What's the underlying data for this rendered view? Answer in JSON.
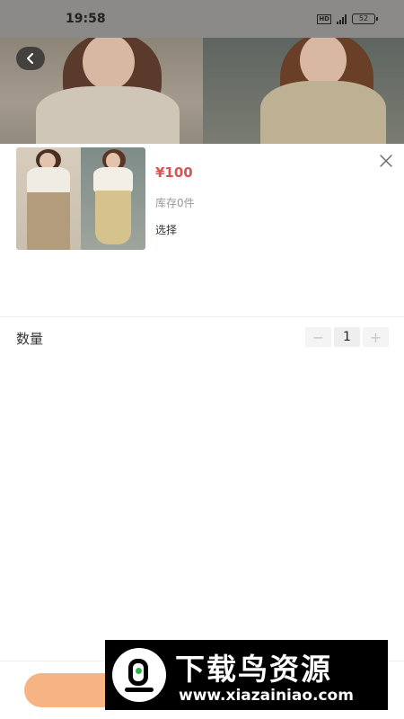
{
  "status_bar": {
    "time": "19:58",
    "hd_badge": "HD",
    "network": "4G",
    "battery": "52"
  },
  "gallery": {
    "back_icon": "chevron-left-icon"
  },
  "sku_sheet": {
    "price": "¥100",
    "stock": "库存0件",
    "select_label": "选择",
    "close_icon": "close-icon",
    "quantity": {
      "label": "数量",
      "value": "1",
      "minus": "−",
      "plus": "+"
    },
    "confirm_color": "#f6b485"
  },
  "watermark": {
    "title": "下载鸟资源",
    "url": "www.xiazainiao.com"
  },
  "colors": {
    "price": "#d9534f",
    "accent": "#f6b485"
  }
}
